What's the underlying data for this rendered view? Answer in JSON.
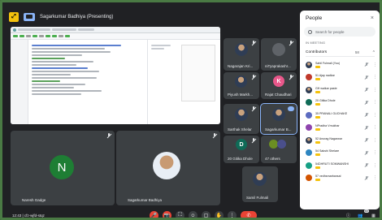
{
  "presenter": {
    "title": "Sagarkumar Badhiya (Presenting)"
  },
  "tiles": [
    {
      "name": "Nagarajan Kri..."
    },
    {
      "name": "niTyaprakashr..."
    },
    {
      "name": "Piyush Markh..."
    },
    {
      "name": "Rajat Chaudhari",
      "initial": "K"
    },
    {
      "name": "Sarthak Shelar"
    },
    {
      "name": "Sagarkumar B..."
    },
    {
      "name": "20 Gitika Dhole",
      "initial": "D"
    },
    {
      "name": "47 others"
    },
    {
      "name": "Samil Fulmali"
    }
  ],
  "big_tiles": [
    {
      "name": "Naresh Gadge",
      "initial": "N"
    },
    {
      "name": "Sagarkumar Badhiya"
    }
  ],
  "people_panel": {
    "title": "People",
    "close": "×",
    "search_placeholder": "Search for people",
    "section": "IN MEETING",
    "contributors_label": "Contributors",
    "contributors_count": "58",
    "items": [
      {
        "name": "Sahil Fulmali (You)"
      },
      {
        "name": "51 Ajay nadkar"
      },
      {
        "name": "GH waikar paste"
      },
      {
        "name": "20 Gitika Dhole"
      },
      {
        "name": "35 PRANALI GUCHAKE"
      },
      {
        "name": "NPradha Vmukhar"
      },
      {
        "name": "52 Anurag Nagarwar"
      },
      {
        "name": "54 Sakshi Shelare"
      },
      {
        "name": "54DHRUTI SOMWANSHI"
      },
      {
        "name": "57 vedhsmarbansal"
      }
    ]
  },
  "bottom": {
    "time_code": "12:43 | cfz-wjfd-stqz",
    "controls": [
      "🎤",
      "📷",
      "⛶",
      "☺",
      "▢",
      "✋",
      "⋮",
      "✆"
    ],
    "right_badge": "60"
  },
  "colors": {
    "accent_red": "#ea4335",
    "avatar_green": "#1e7e34",
    "avatar_pink": "#e8578a",
    "avatar_teal": "#0f6b57",
    "badge_yellow": "#f4c20d"
  }
}
